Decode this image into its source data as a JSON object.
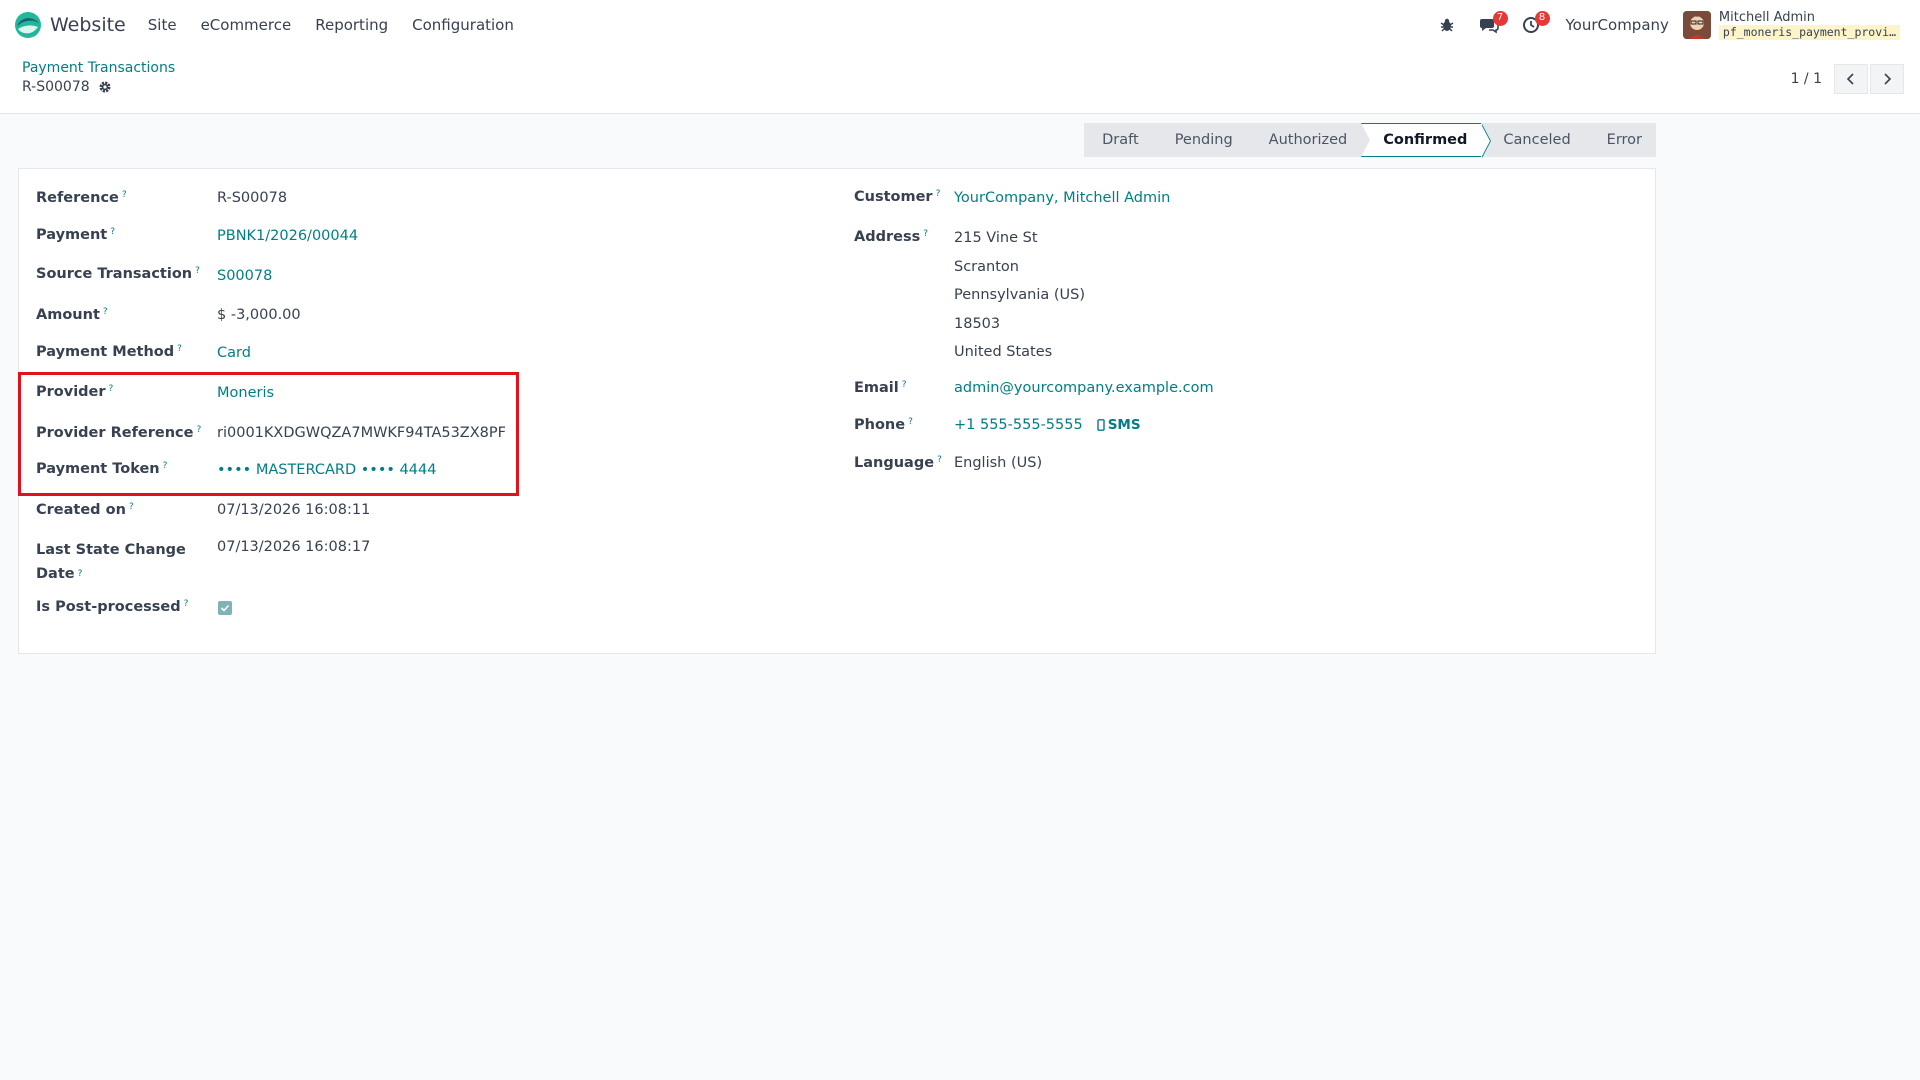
{
  "navbar": {
    "app_name": "Website",
    "menu": [
      "Site",
      "eCommerce",
      "Reporting",
      "Configuration"
    ],
    "messages_count": "7",
    "activities_count": "8",
    "company": "YourCompany",
    "user_name": "Mitchell Admin",
    "db_name": "pf_moneris_payment_provi…"
  },
  "control_panel": {
    "breadcrumb": "Payment Transactions",
    "record_name": "R-S00078",
    "pager": "1 / 1"
  },
  "statusbar": {
    "stages": [
      "Draft",
      "Pending",
      "Authorized",
      "Confirmed",
      "Canceled",
      "Error"
    ],
    "active": "Confirmed"
  },
  "form": {
    "left": {
      "reference_label": "Reference",
      "reference": "R-S00078",
      "payment_label": "Payment",
      "payment": "PBNK1/2026/00044",
      "source_label": "Source Transaction",
      "source": "S00078",
      "amount_label": "Amount",
      "amount": "$ -3,000.00",
      "method_label": "Payment Method",
      "method": "Card",
      "provider_label": "Provider",
      "provider": "Moneris",
      "provider_ref_label": "Provider Reference",
      "provider_ref": "ri0001KXDGWQZA7MWKF94TA53ZX8PF",
      "token_label": "Payment Token",
      "token": "•••• MASTERCARD •••• 4444",
      "created_label": "Created on",
      "created": "07/13/2026 16:08:11",
      "last_state_label_1": "Last State Change",
      "last_state_label_2": "Date",
      "last_state": "07/13/2026 16:08:17",
      "post_processed_label": "Is Post-processed",
      "post_processed": true
    },
    "right": {
      "customer_label": "Customer",
      "customer": "YourCompany, Mitchell Admin",
      "address_label": "Address",
      "address": [
        "215 Vine St",
        "Scranton",
        "Pennsylvania (US)",
        "18503",
        "United States"
      ],
      "email_label": "Email",
      "email": "admin@yourcompany.example.com",
      "phone_label": "Phone",
      "phone": "+1 555-555-5555",
      "sms_label": "SMS",
      "language_label": "Language",
      "language": "English (US)"
    }
  },
  "help_mark": "?",
  "colors": {
    "accent": "#017e84",
    "highlight": "#e1121b",
    "badge": "#e53935"
  }
}
